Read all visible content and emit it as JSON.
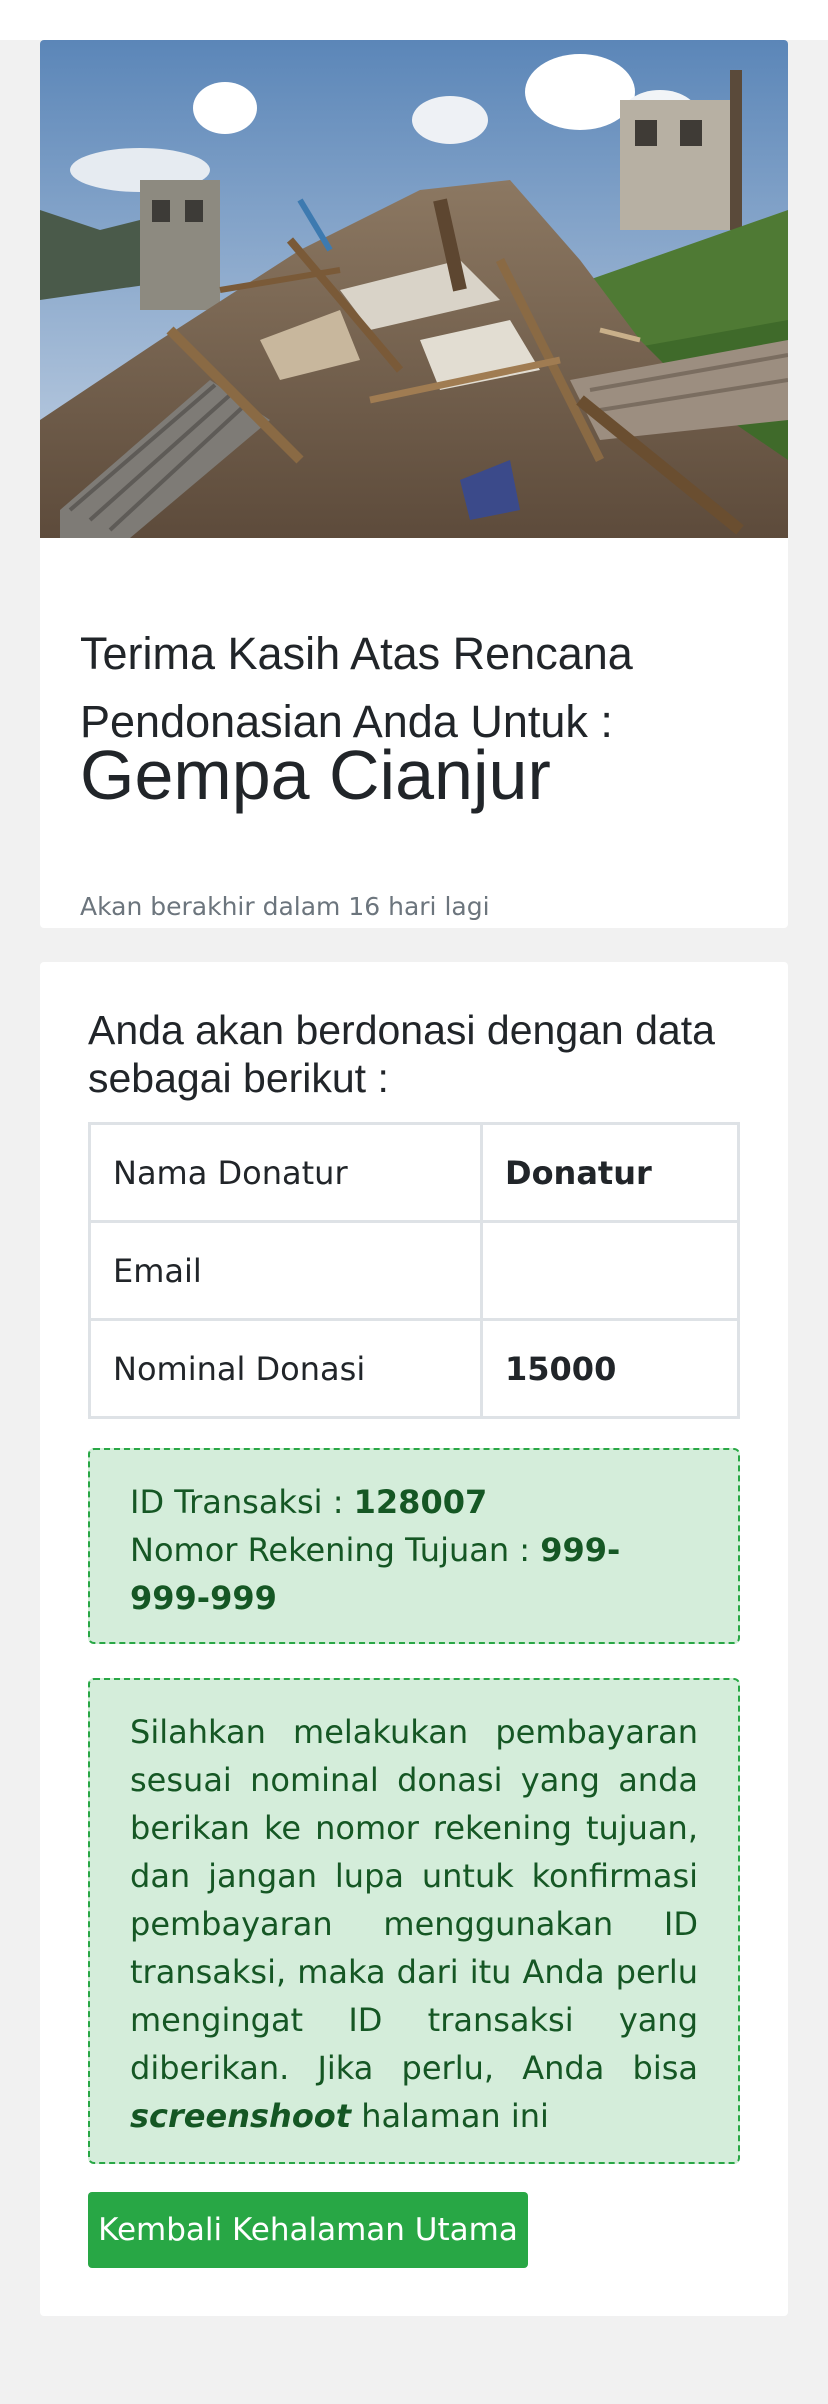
{
  "hero": {
    "image_description": "Collapsed houses and debris after an earthquake"
  },
  "campaign": {
    "thanks_line1": "Terima Kasih Atas Rencana",
    "thanks_line2": "Pendonasian Anda Untuk :",
    "title": "Gempa Cianjur",
    "deadline": "Akan berakhir dalam 16 hari lagi"
  },
  "donation": {
    "intro": "Anda akan berdonasi dengan data sebagai berikut :",
    "rows": [
      {
        "label": "Nama Donatur",
        "value": "Donatur"
      },
      {
        "label": "Email",
        "value": ""
      },
      {
        "label": "Nominal Donasi",
        "value": "15000"
      }
    ]
  },
  "transaction": {
    "id_label": "ID Transaksi : ",
    "id_value": "128007",
    "account_label": "Nomor Rekening Tujuan : ",
    "account_value": "999-999-999"
  },
  "notice": {
    "text_before": "Silahkan melakukan pembayaran sesuai nominal donasi yang anda berikan ke nomor rekening tujuan, dan jangan lupa untuk konfirmasi pembayaran menggunakan ID transaksi, maka dari itu Anda perlu mengingat ID transaksi yang diberikan. Jika perlu, Anda bisa ",
    "emphasis": "screenshoot",
    "text_after": " halaman ini"
  },
  "actions": {
    "back_label": "Kembali Kehalaman Utama"
  },
  "colors": {
    "success": "#28a745",
    "alert_bg": "#d4edda",
    "alert_text": "#155724",
    "page_bg": "#f1f1f1"
  }
}
